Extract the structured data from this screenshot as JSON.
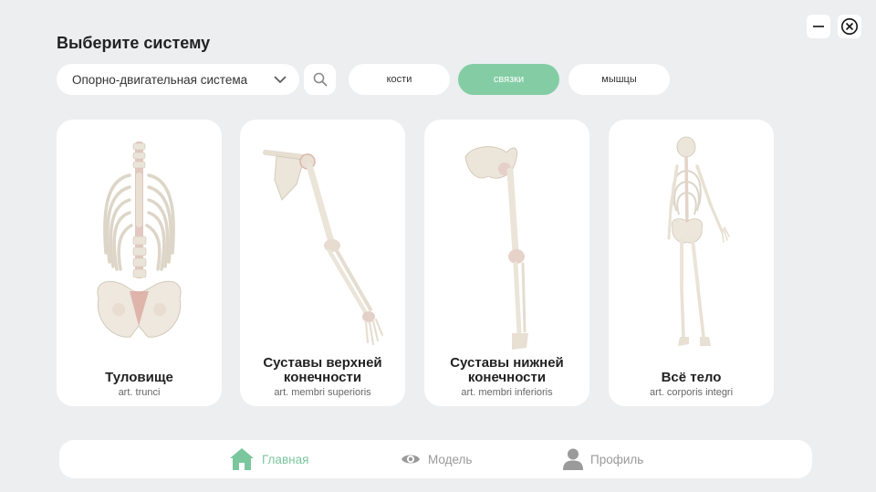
{
  "window_controls": {
    "minimize_icon": "minimize-icon",
    "close_icon": "close-icon"
  },
  "header": {
    "title": "Выберите систему"
  },
  "system_select": {
    "value": "Опорно-двигательная система",
    "icon": "chevron-down-icon"
  },
  "search": {
    "icon": "search-icon"
  },
  "segments": [
    {
      "label": "кости",
      "active": false
    },
    {
      "label": "связки",
      "active": true
    },
    {
      "label": "мышцы",
      "active": false
    }
  ],
  "cards": [
    {
      "title": "Туловище",
      "subtitle": "art. trunci"
    },
    {
      "title": "Суставы верхней конечности",
      "subtitle": "art. membri superioris"
    },
    {
      "title": "Суставы нижней конечности",
      "subtitle": "art. membri inferioris"
    },
    {
      "title": "Всё тело",
      "subtitle": "art. corporis integri"
    }
  ],
  "nav": [
    {
      "label": "Главная",
      "icon": "home-icon",
      "active": true
    },
    {
      "label": "Модель",
      "icon": "eye-icon",
      "active": false
    },
    {
      "label": "Профиль",
      "icon": "user-icon",
      "active": false
    }
  ],
  "colors": {
    "accent": "#84cda4",
    "background": "#eceef0",
    "card": "#ffffff",
    "bone": "#ece6da",
    "ligament": "#d9a9a0"
  }
}
